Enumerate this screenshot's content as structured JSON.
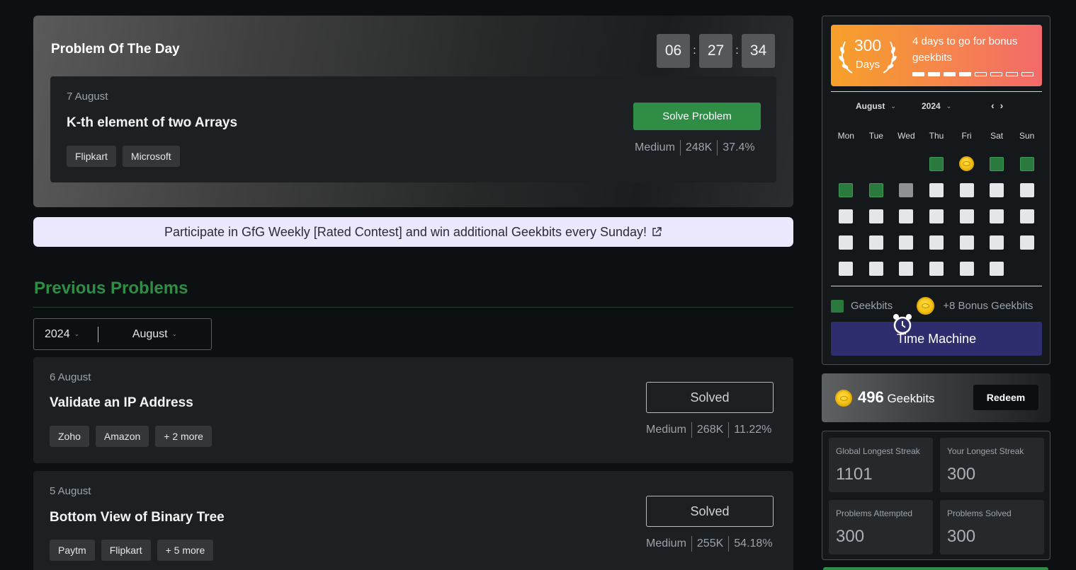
{
  "potd": {
    "title": "Problem Of The Day",
    "timer": [
      "06",
      "27",
      "34"
    ],
    "date": "7 August",
    "problem": "K-th element of two Arrays",
    "tags": [
      "Flipkart",
      "Microsoft"
    ],
    "solve_label": "Solve Problem",
    "difficulty": "Medium",
    "submissions": "248K",
    "accuracy": "37.4%"
  },
  "banner": {
    "text": "Participate in GfG Weekly [Rated Contest] and win additional Geekbits every Sunday!"
  },
  "previous": {
    "title": "Previous Problems",
    "year": "2024",
    "month": "August",
    "problems": [
      {
        "date": "6 August",
        "name": "Validate an IP Address",
        "tags": [
          "Zoho",
          "Amazon",
          "+ 2 more"
        ],
        "status": "Solved",
        "difficulty": "Medium",
        "submissions": "268K",
        "accuracy": "11.22%"
      },
      {
        "date": "5 August",
        "name": "Bottom View of Binary Tree",
        "tags": [
          "Paytm",
          "Flipkart",
          "+ 5 more"
        ],
        "status": "Solved",
        "difficulty": "Medium",
        "submissions": "255K",
        "accuracy": "54.18%"
      }
    ]
  },
  "streak": {
    "days": "300",
    "days_label": "Days",
    "message": "4 days to go for bonus geekbits",
    "progress_filled": 4,
    "progress_total": 8
  },
  "calendar": {
    "month": "August",
    "year": "2024",
    "weekdays": [
      "Mon",
      "Tue",
      "Wed",
      "Thu",
      "Fri",
      "Sat",
      "Sun"
    ],
    "rows": [
      [
        "",
        "",
        "",
        "g",
        "coin",
        "g",
        "g"
      ],
      [
        "g",
        "g",
        "gr",
        "w",
        "w",
        "w",
        "w"
      ],
      [
        "w",
        "w",
        "w",
        "w",
        "w",
        "w",
        "w"
      ],
      [
        "w",
        "w",
        "w",
        "w",
        "w",
        "w",
        "w"
      ],
      [
        "w",
        "w",
        "w",
        "w",
        "w",
        "w",
        ""
      ]
    ],
    "legend_geekbits": "Geekbits",
    "legend_bonus": "+8 Bonus Geekbits",
    "time_machine": "Time Machine"
  },
  "geekbits": {
    "count": "496",
    "label": "Geekbits",
    "redeem": "Redeem"
  },
  "stats": [
    {
      "label": "Global Longest Streak",
      "value": "1101"
    },
    {
      "label": "Your Longest Streak",
      "value": "300"
    },
    {
      "label": "Problems Attempted",
      "value": "300"
    },
    {
      "label": "Problems Solved",
      "value": "300"
    }
  ],
  "colors": {
    "accent_green": "#2f8d46",
    "time_machine_bg": "#2e2e6e",
    "banner_bg": "#ece8fd"
  }
}
